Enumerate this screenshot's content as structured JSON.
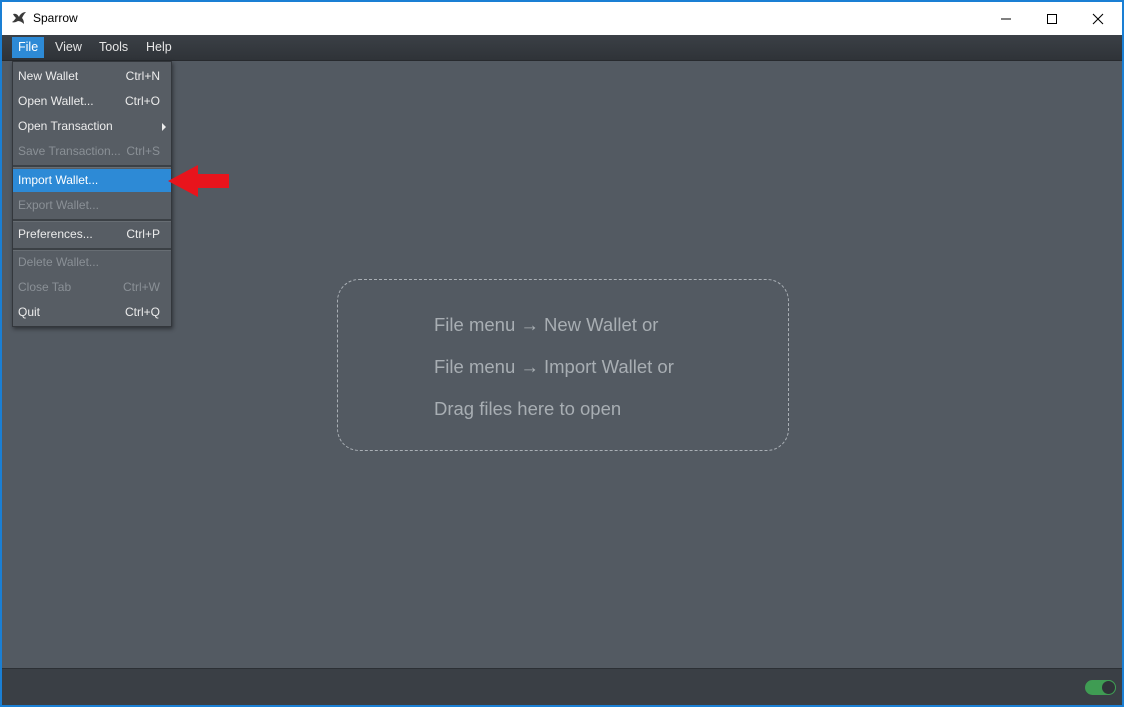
{
  "window": {
    "title": "Sparrow"
  },
  "menubar": {
    "items": [
      "File",
      "View",
      "Tools",
      "Help"
    ]
  },
  "file_menu": {
    "items": [
      {
        "label": "New Wallet",
        "shortcut": "Ctrl+N"
      },
      {
        "label": "Open Wallet...",
        "shortcut": "Ctrl+O"
      },
      {
        "label": "Open Transaction",
        "shortcut": ""
      },
      {
        "label": "Save Transaction...",
        "shortcut": "Ctrl+S"
      },
      {
        "label": "Import Wallet...",
        "shortcut": ""
      },
      {
        "label": "Export Wallet...",
        "shortcut": ""
      },
      {
        "label": "Preferences...",
        "shortcut": "Ctrl+P"
      },
      {
        "label": "Delete Wallet...",
        "shortcut": ""
      },
      {
        "label": "Close Tab",
        "shortcut": "Ctrl+W"
      },
      {
        "label": "Quit",
        "shortcut": "Ctrl+Q"
      }
    ]
  },
  "dropzone": {
    "lines": [
      "File menu → New Wallet or",
      "File menu → Import Wallet or",
      "Drag files here to open"
    ]
  },
  "colors": {
    "accent": "#2d8ad6",
    "arrow": "#e8141c",
    "toggle_on": "#3f9c53"
  }
}
